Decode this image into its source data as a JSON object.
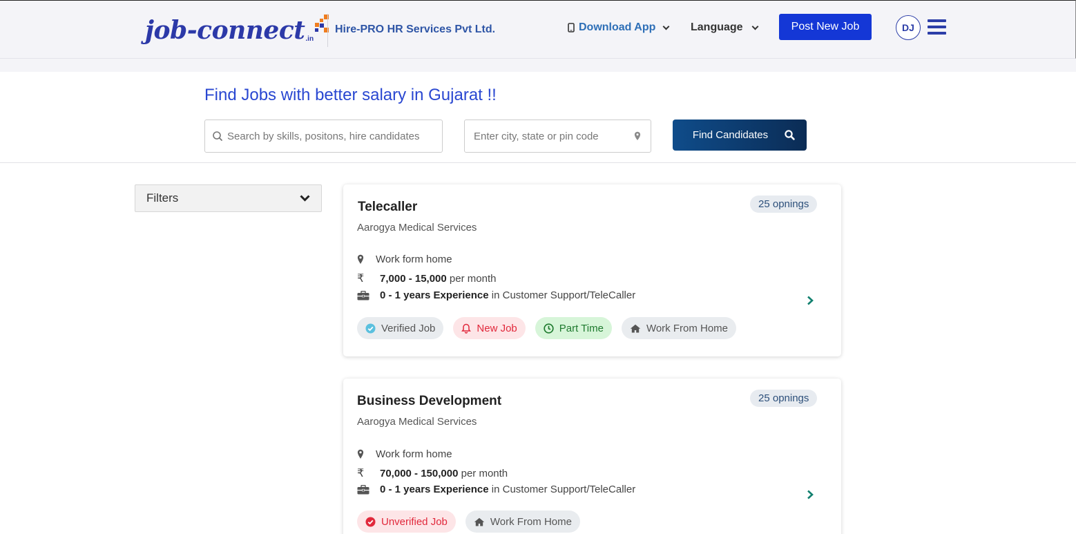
{
  "header": {
    "logo_text": "job-connect",
    "logo_suffix": ".in",
    "company": "Hire-PRO HR Services Pvt Ltd.",
    "download_app": "Download App",
    "language": "Language",
    "post_job": "Post New Job",
    "avatar_initials": "DJ",
    "colors": {
      "brand": "#2c39a8",
      "accent_orange": "#ef7d1f",
      "post_button": "#1437d6"
    }
  },
  "search": {
    "headline": "Find Jobs with better salary in Gujarat !!",
    "keyword_placeholder": "Search by skills, positons, hire candidates",
    "location_placeholder": "Enter city, state or pin code",
    "button_label": "Find Candidates"
  },
  "filters": {
    "label": "Filters"
  },
  "jobs": [
    {
      "title": "Telecaller",
      "company": "Aarogya Medical Services",
      "openings": "25 opnings",
      "location": "Work form home",
      "salary_range": "7,000 - 15,000",
      "salary_period": "per month",
      "experience": "0 - 1 years Experience",
      "experience_suffix": "in Customer Support/TeleCaller",
      "tags": [
        "Verified Job",
        "New Job",
        "Part Time",
        "Work From Home"
      ]
    },
    {
      "title": "Business Development",
      "company": "Aarogya Medical Services",
      "openings": "25 opnings",
      "location": "Work form home",
      "salary_range": "70,000 - 150,000",
      "salary_period": "per month",
      "experience": "0 - 1 years Experience",
      "experience_suffix": "in Customer Support/TeleCaller",
      "tags": [
        "Unverified Job",
        "Work From Home"
      ]
    }
  ],
  "icons": {
    "rupee": "₹",
    "location": "map-pin-icon",
    "briefcase": "briefcase-icon",
    "search": "search-icon",
    "next": "chevron-right-icon"
  }
}
